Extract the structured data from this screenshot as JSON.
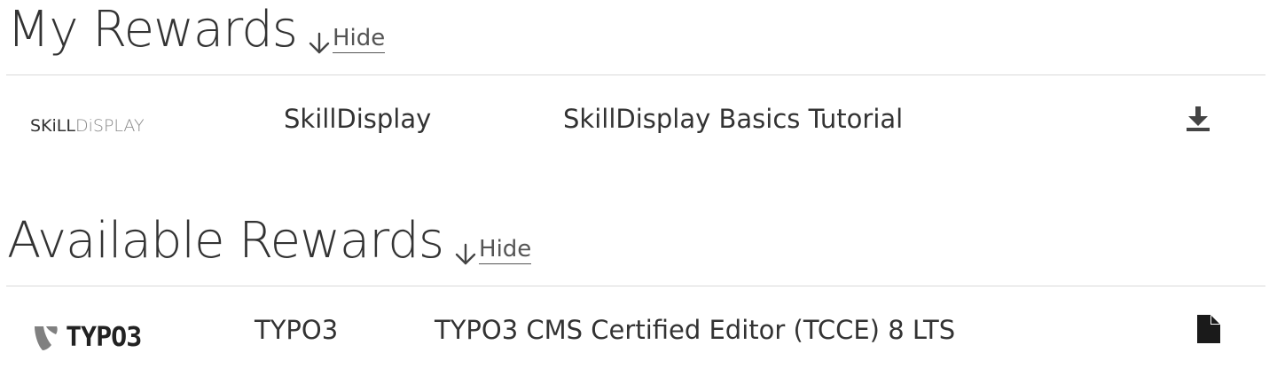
{
  "my_rewards": {
    "title": "My Rewards",
    "toggle_label": "Hide",
    "items": [
      {
        "logo_part_a": "SKiLL",
        "logo_part_b": "DiSPLAY",
        "provider": "SkillDisplay",
        "name": "SkillDisplay Basics Tutorial",
        "action_icon": "download-icon"
      }
    ]
  },
  "available_rewards": {
    "title": "Available Rewards",
    "toggle_label": "Hide",
    "items": [
      {
        "logo_text": "TYPO3",
        "provider": "TYPO3",
        "name": "TYPO3 CMS Certified Editor (TCCE) 8 LTS",
        "action_icon": "document-icon"
      }
    ]
  },
  "colors": {
    "text": "#333333",
    "divider": "#d9d9d9",
    "link": "#555555"
  }
}
